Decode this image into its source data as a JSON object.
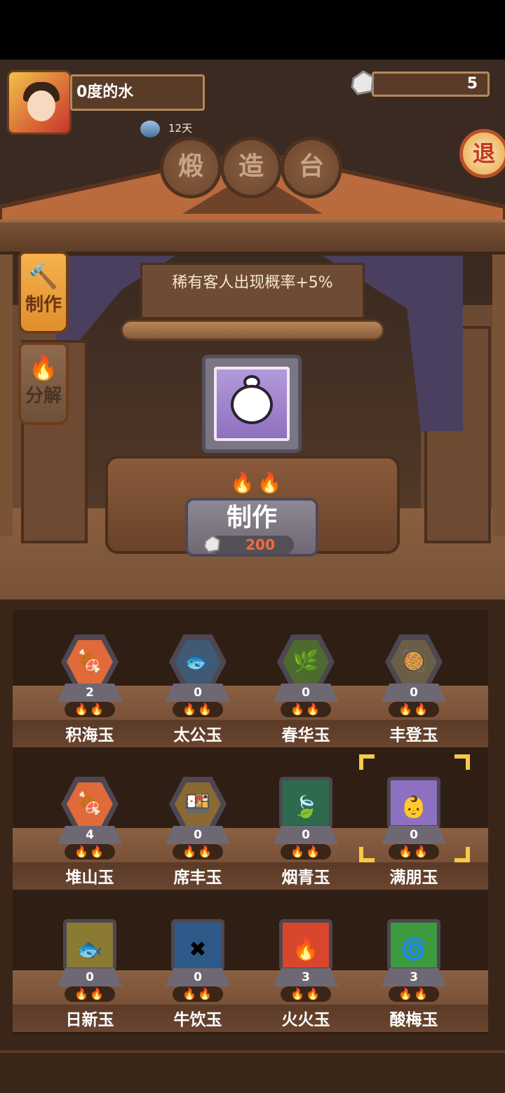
{
  "player": {
    "name": "0度的水",
    "days": "12天"
  },
  "currency": {
    "stone_count": "5"
  },
  "title_chars": [
    "煅",
    "造",
    "台"
  ],
  "exit_label": "退",
  "side_tabs": [
    {
      "label": "制作",
      "icon": "hammer-icon",
      "active": true
    },
    {
      "label": "分解",
      "icon": "flame-icon",
      "active": false
    }
  ],
  "banner_text": "稀有客人出现概率+5%",
  "selected_item": {
    "icon": "baby-face-icon"
  },
  "craft": {
    "label": "制作",
    "cost": "200",
    "flames": "🔥🔥"
  },
  "items": [
    {
      "name": "积海玉",
      "count": "2",
      "shape": "hex",
      "bg": "#e06a3a",
      "sym": "🍖"
    },
    {
      "name": "太公玉",
      "count": "0",
      "shape": "hex",
      "bg": "#3f5a72",
      "sym": "🐟"
    },
    {
      "name": "春华玉",
      "count": "0",
      "shape": "hex",
      "bg": "#4e6a2e",
      "sym": "🌿"
    },
    {
      "name": "丰登玉",
      "count": "0",
      "shape": "hex",
      "bg": "#6a5e46",
      "sym": "🥘"
    },
    {
      "name": "堆山玉",
      "count": "4",
      "shape": "hex",
      "bg": "#e06a3a",
      "sym": "🍖"
    },
    {
      "name": "席丰玉",
      "count": "0",
      "shape": "hex",
      "bg": "#8a6a32",
      "sym": "🍱"
    },
    {
      "name": "烟青玉",
      "count": "0",
      "shape": "sq",
      "bg": "#2e6a4e",
      "sym": "🍃"
    },
    {
      "name": "满朋玉",
      "count": "0",
      "shape": "sq",
      "bg": "#8e70c0",
      "sym": "👶"
    },
    {
      "name": "日新玉",
      "count": "0",
      "shape": "sq",
      "bg": "#8a7a32",
      "sym": "🐟"
    },
    {
      "name": "牛饮玉",
      "count": "0",
      "shape": "sq",
      "bg": "#2e5a8a",
      "sym": "✖"
    },
    {
      "name": "火火玉",
      "count": "3",
      "shape": "sq",
      "bg": "#d8472c",
      "sym": "🔥"
    },
    {
      "name": "酸梅玉",
      "count": "3",
      "shape": "sq",
      "bg": "#3e9a3e",
      "sym": "🌀"
    }
  ],
  "cell_flames": "🔥🔥",
  "selected_index": 7
}
